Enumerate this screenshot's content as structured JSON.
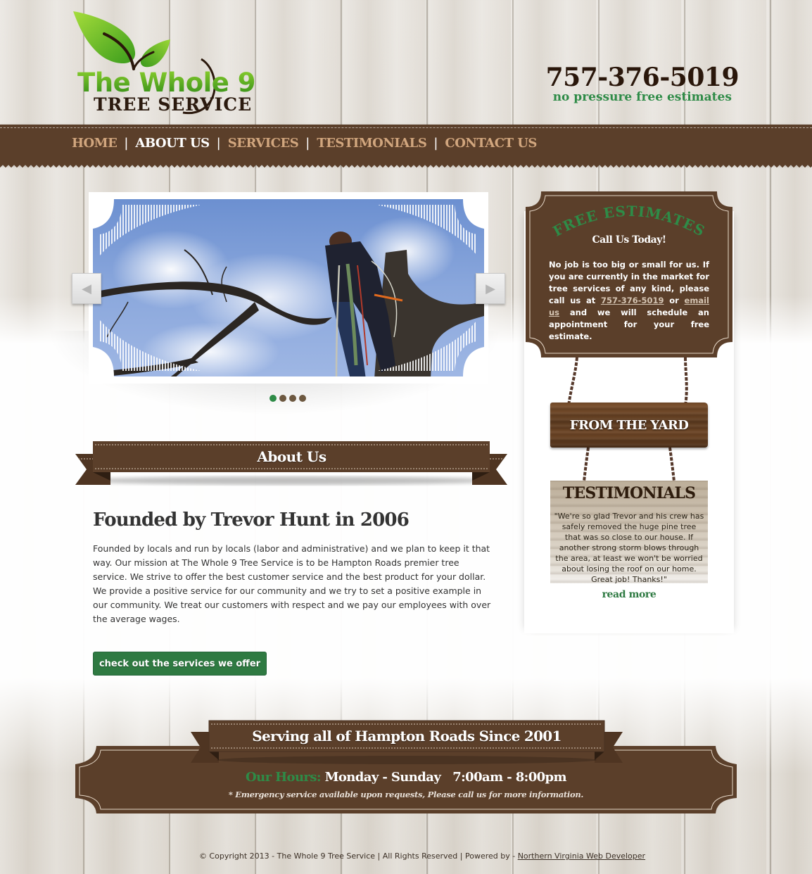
{
  "header": {
    "logo": {
      "line1": "The Whole 9",
      "line2": "TREE SERVICE",
      "icon": "leaf-icon"
    },
    "phone": "757-376-5019",
    "tagline": "no pressure free estimates"
  },
  "nav": {
    "items": [
      {
        "label": "HOME",
        "active": false
      },
      {
        "label": "ABOUT US",
        "active": true
      },
      {
        "label": "SERVICES",
        "active": false
      },
      {
        "label": "TESTIMONIALS",
        "active": false
      },
      {
        "label": "CONTACT US",
        "active": false
      }
    ],
    "separator": "|"
  },
  "slider": {
    "prev_icon": "chevron-left-icon",
    "next_icon": "chevron-right-icon",
    "prev_glyph": "◀",
    "next_glyph": "▶",
    "slide_count": 4,
    "active_slide": 1
  },
  "about": {
    "ribbon_title": "About Us",
    "heading": "Founded by Trevor Hunt in 2006",
    "body": "Founded by locals and run by locals (labor and administrative) and we plan to keep it that way. Our mission at The Whole 9 Tree Service is to be Hampton Roads premier tree service. We strive to offer the best customer service and the best product for your dollar. We provide a positive service for our community and we try to set a positive example in our community. We treat our customers with respect and we pay our employees with over the average wages.",
    "cta_label": "check out the services we offer"
  },
  "sidebar": {
    "estimate": {
      "title": "FREE ESTIMATES",
      "subtitle": "Call Us Today!",
      "body_before": "No job is too big or small for us. If you are currently in the market for tree services of any kind, please call us at ",
      "phone_link": "757-376-5019",
      "body_middle": " or ",
      "email_link": "email us",
      "body_after": " and we will schedule an appointment for your free estimate."
    },
    "yard_sign": "FROM THE YARD",
    "testimonials": {
      "title": "TESTIMONIALS",
      "quote": "\"We're so glad Trevor and his crew has safely removed the huge pine tree that was so close to our house. If another strong storm blows through the area, at least we won't be worried about losing the roof on our home. Great job! Thanks!\"",
      "read_more": "read more"
    }
  },
  "footer": {
    "ribbon_title": "Serving all of Hampton Roads Since 2001",
    "hours_label": "Our Hours:",
    "hours_days": "Monday - Sunday",
    "hours_times": "7:00am - 8:00pm",
    "note": "* Emergency service available upon requests, Please call us for more information.",
    "copyright": "© Copyright 2013 - The Whole 9 Tree Service | All Rights Reserved | Powered by - ",
    "developer_link": "Northern Virginia Web Developer"
  },
  "colors": {
    "brown": "#5b3f2a",
    "green": "#2e8b47",
    "nav_text": "#d1a67e",
    "nav_active": "#ffffff"
  }
}
